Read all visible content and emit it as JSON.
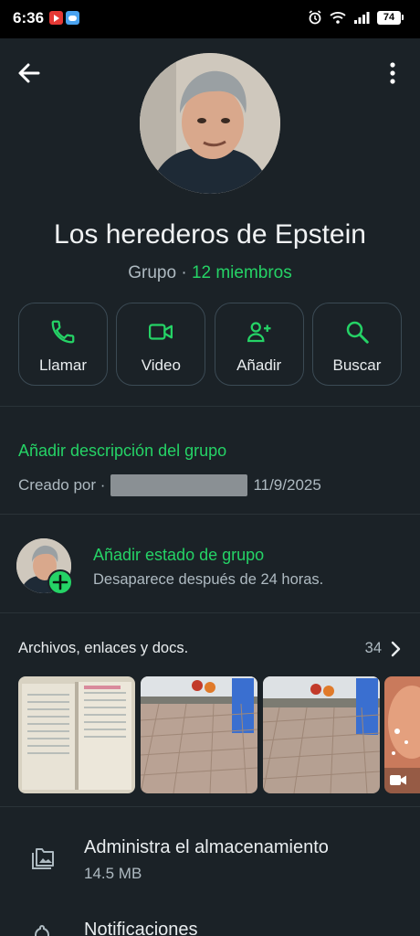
{
  "status_bar": {
    "time": "6:36",
    "battery": "74"
  },
  "header": {
    "group_name": "Los herederos de Epstein",
    "group_label": "Grupo",
    "separator": " · ",
    "members": "12 miembros"
  },
  "actions": [
    {
      "label": "Llamar",
      "icon": "phone-icon"
    },
    {
      "label": "Video",
      "icon": "video-icon"
    },
    {
      "label": "Añadir",
      "icon": "add-person-icon"
    },
    {
      "label": "Buscar",
      "icon": "search-icon"
    }
  ],
  "description": {
    "add_label": "Añadir descripción del grupo",
    "created_prefix": "Creado por ·",
    "created_date": "11/9/2025"
  },
  "group_status": {
    "title": "Añadir estado de grupo",
    "subtitle": "Desaparece después de 24 horas."
  },
  "files": {
    "title": "Archivos, enlaces y docs.",
    "count": "34"
  },
  "storage": {
    "title": "Administra el almacenamiento",
    "size": "14.5 MB"
  },
  "notifications": {
    "title": "Notificaciones"
  },
  "colors": {
    "accent": "#25d366",
    "background": "#1b2227",
    "secondary_text": "#aebac1"
  }
}
